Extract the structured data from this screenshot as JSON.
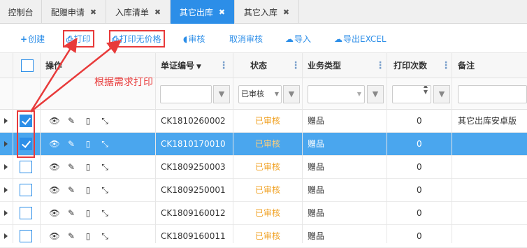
{
  "tabs": [
    {
      "label": "控制台",
      "closable": false,
      "active": false
    },
    {
      "label": "配赠申请",
      "closable": true,
      "active": false
    },
    {
      "label": "入库清单",
      "closable": true,
      "active": false
    },
    {
      "label": "其它出库",
      "closable": true,
      "active": true
    },
    {
      "label": "其它入库",
      "closable": true,
      "active": false
    }
  ],
  "close_glyph": "✖",
  "toolbar": {
    "create": "创建",
    "print": "打印",
    "print_no_price": "打印无价格",
    "audit": "审核",
    "cancel_audit": "取消审核",
    "import": "导入",
    "export_excel": "导出EXCEL"
  },
  "columns": {
    "ops": "操作",
    "doc_no": "单证编号",
    "status": "状态",
    "biz_type": "业务类型",
    "print_count": "打印次数",
    "remark": "备注"
  },
  "filters": {
    "status_value": "已审核"
  },
  "rows": [
    {
      "checked": true,
      "selected": false,
      "doc_no": "CK1810260002",
      "status": "已审核",
      "biz_type": "赠品",
      "print_count": "0",
      "remark": "其它出库安卓版"
    },
    {
      "checked": true,
      "selected": true,
      "doc_no": "CK1810170010",
      "status": "已审核",
      "biz_type": "赠品",
      "print_count": "0",
      "remark": ""
    },
    {
      "checked": false,
      "selected": false,
      "doc_no": "CK1809250003",
      "status": "已审核",
      "biz_type": "赠品",
      "print_count": "0",
      "remark": ""
    },
    {
      "checked": false,
      "selected": false,
      "doc_no": "CK1809250001",
      "status": "已审核",
      "biz_type": "赠品",
      "print_count": "0",
      "remark": ""
    },
    {
      "checked": false,
      "selected": false,
      "doc_no": "CK1809160012",
      "status": "已审核",
      "biz_type": "赠品",
      "print_count": "0",
      "remark": ""
    },
    {
      "checked": false,
      "selected": false,
      "doc_no": "CK1809160011",
      "status": "已审核",
      "biz_type": "赠品",
      "print_count": "0",
      "remark": ""
    }
  ],
  "annotation": "根据需求打印",
  "colors": {
    "accent": "#2c8ee8",
    "selected_row": "#4aa6ee",
    "status": "#f0a020",
    "annotation": "#e83a3a"
  }
}
